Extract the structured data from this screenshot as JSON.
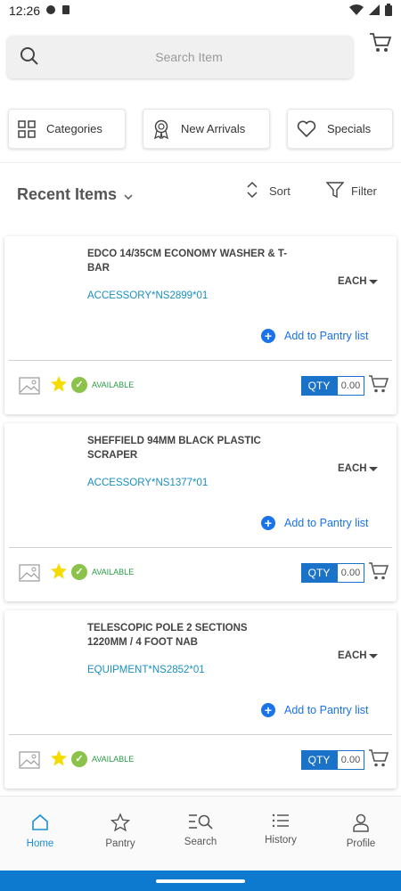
{
  "status": {
    "time": "12:26"
  },
  "search": {
    "placeholder": "Search Item"
  },
  "quick_links": [
    {
      "label": "Categories",
      "icon": "grid-icon"
    },
    {
      "label": "New Arrivals",
      "icon": "award-icon"
    },
    {
      "label": "Specials",
      "icon": "heart-icon"
    }
  ],
  "section": {
    "title": "Recent Items",
    "sort_label": "Sort",
    "filter_label": "Filter"
  },
  "items": [
    {
      "name": "EDCO 14/35CM ECONOMY WASHER & T-BAR",
      "code": "ACCESSORY*NS2899*01",
      "uom": "EACH",
      "pantry_label": "Add to Pantry list",
      "availability": "AVAILABLE",
      "qty_label": "QTY",
      "qty_value": "0.00"
    },
    {
      "name": "SHEFFIELD 94MM BLACK PLASTIC SCRAPER",
      "code": "ACCESSORY*NS1377*01",
      "uom": "EACH",
      "pantry_label": "Add to Pantry list",
      "availability": "AVAILABLE",
      "qty_label": "QTY",
      "qty_value": "0.00"
    },
    {
      "name": "TELESCOPIC POLE 2 SECTIONS 1220MM / 4 FOOT NAB",
      "code": "EQUIPMENT*NS2852*01",
      "uom": "EACH",
      "pantry_label": "Add to Pantry list",
      "availability": "AVAILABLE",
      "qty_label": "QTY",
      "qty_value": "0.00"
    }
  ],
  "nav": [
    {
      "label": "Home",
      "icon": "home-icon",
      "active": true
    },
    {
      "label": "Pantry",
      "icon": "star-outline-icon",
      "active": false
    },
    {
      "label": "Search",
      "icon": "search-list-icon",
      "active": false
    },
    {
      "label": "History",
      "icon": "list-icon",
      "active": false
    },
    {
      "label": "Profile",
      "icon": "person-icon",
      "active": false
    }
  ],
  "colors": {
    "accent": "#1a73c8",
    "link": "#1a8fc0",
    "available": "#2a9a46",
    "nav_active": "#1a8fd8",
    "star": "#f5dc00"
  }
}
